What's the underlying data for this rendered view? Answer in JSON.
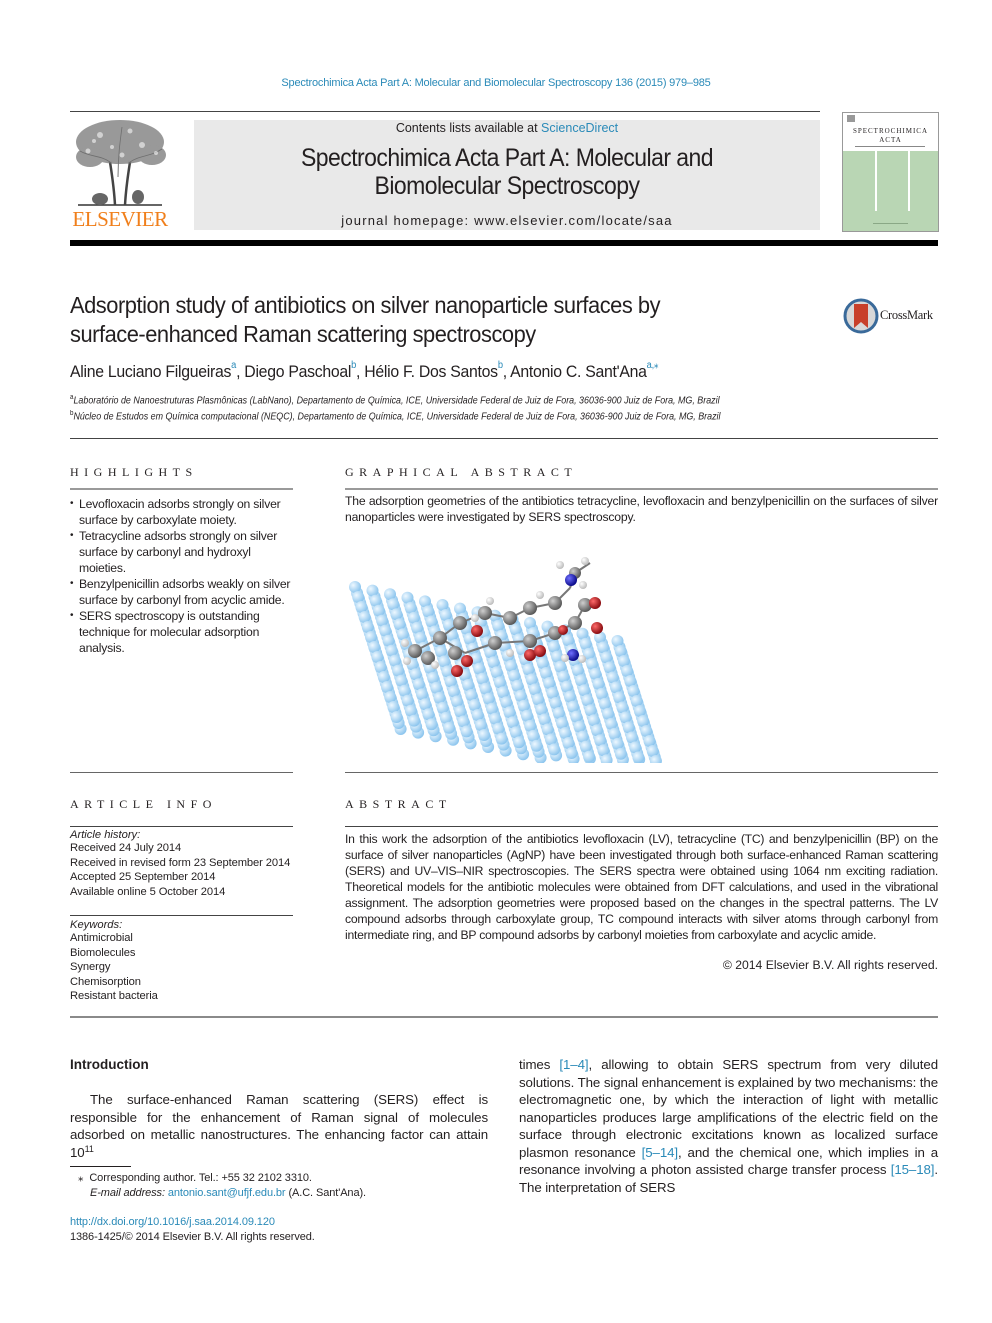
{
  "running_head": "Spectrochimica Acta Part A: Molecular and Biomolecular Spectroscopy 136 (2015) 979–985",
  "masthead": {
    "publisher": "ELSEVIER",
    "contents_prefix": "Contents lists available at ",
    "contents_link": "ScienceDirect",
    "journal_title_line1": "Spectrochimica Acta Part A: Molecular and",
    "journal_title_line2": "Biomolecular Spectroscopy",
    "homepage_prefix": "journal homepage: ",
    "homepage_url": "www.elsevier.com/locate/saa",
    "cover_title_line1": "SPECTROCHIMICA",
    "cover_title_line2": "ACTA"
  },
  "article": {
    "title_line1": "Adsorption study of antibiotics on silver nanoparticle surfaces by",
    "title_line2": "surface-enhanced Raman scattering spectroscopy",
    "crossmark_label": "CrossMark",
    "authors": [
      {
        "name": "Aline Luciano Filgueiras",
        "sup": "a",
        "sep": ", "
      },
      {
        "name": "Diego Paschoal",
        "sup": "b",
        "sep": ", "
      },
      {
        "name": "Hélio F. Dos Santos",
        "sup": "b",
        "sep": ", "
      },
      {
        "name": "Antonio C. Sant'Ana",
        "sup": "a,⁎",
        "sep": ""
      }
    ],
    "affiliations": [
      {
        "mark": "a",
        "text": "Laboratório de Nanoestruturas Plasmônicas (LabNano), Departamento de Química, ICE, Universidade Federal de Juiz de Fora, 36036-900 Juiz de Fora, MG, Brazil"
      },
      {
        "mark": "b",
        "text": "Núcleo de Estudos em Química computacional (NEQC), Departamento de Química, ICE, Universidade Federal de Juiz de Fora, 36036-900 Juiz de Fora, MG, Brazil"
      }
    ]
  },
  "highlights": {
    "heading": "HIGHLIGHTS",
    "items": [
      "Levofloxacin adsorbs strongly on silver surface by carboxylate moiety.",
      "Tetracycline adsorbs strongly on silver surface by carbonyl and hydroxyl moieties.",
      "Benzylpenicillin adsorbs weakly on silver surface by carbonyl from acyclic amide.",
      "SERS spectroscopy is outstanding technique for molecular adsorption analysis."
    ]
  },
  "graphical_abstract": {
    "heading": "GRAPHICAL ABSTRACT",
    "text": "The adsorption geometries of the antibiotics tetracycline, levofloxacin and benzylpenicillin on the surfaces of silver nanoparticles were investigated by SERS spectroscopy.",
    "image_alt": "Molecular model of an antibiotic adsorbed on a silver nanoparticle lattice"
  },
  "article_info": {
    "heading": "ARTICLE INFO",
    "history_label": "Article history:",
    "history": [
      "Received 24 July 2014",
      "Received in revised form 23 September 2014",
      "Accepted 25 September 2014",
      "Available online 5 October 2014"
    ],
    "keywords_label": "Keywords:",
    "keywords": [
      "Antimicrobial",
      "Biomolecules",
      "Synergy",
      "Chemisorption",
      "Resistant bacteria"
    ]
  },
  "abstract": {
    "heading": "ABSTRACT",
    "text": "In this work the adsorption of the antibiotics levofloxacin (LV), tetracycline (TC) and benzylpenicillin (BP) on the surface of silver nanoparticles (AgNP) have been investigated through both surface-enhanced Raman scattering (SERS) and UV–VIS–NIR spectroscopies. The SERS spectra were obtained using 1064 nm exciting radiation. Theoretical models for the antibiotic molecules were obtained from DFT calculations, and used in the vibrational assignment. The adsorption geometries were proposed based on the changes in the spectral patterns. The LV compound adsorbs through carboxylate group, TC compound interacts with silver atoms through carbonyl from intermediate ring, and BP compound adsorbs by carbonyl moieties from carboxylate and acyclic amide.",
    "copyright": "© 2014 Elsevier B.V. All rights reserved."
  },
  "introduction": {
    "heading": "Introduction",
    "left_text": "The surface-enhanced Raman scattering (SERS) effect is responsible for the enhancement of Raman signal of molecules adsorbed on metallic nanostructures. The enhancing factor can attain 10",
    "left_sup": "11",
    "right_segments": [
      {
        "t": "times ",
        "ref": false
      },
      {
        "t": "[1–4]",
        "ref": true
      },
      {
        "t": ", allowing to obtain SERS spectrum from very diluted solutions. The signal enhancement is explained by two mechanisms: the electromagnetic one, by which the interaction of light with metallic nanoparticles produces large amplifications of the electric field on the surface through electronic excitations known as localized surface plasmon resonance ",
        "ref": false
      },
      {
        "t": "[5–14]",
        "ref": true
      },
      {
        "t": ", and the chemical one, which implies in a resonance involving a photon assisted charge transfer process ",
        "ref": false
      },
      {
        "t": "[15–18]",
        "ref": true
      },
      {
        "t": ". The interpretation of SERS",
        "ref": false
      }
    ]
  },
  "footnotes": {
    "corresponding_mark": "⁎",
    "corresponding": "Corresponding author. Tel.: +55 32 2102 3310.",
    "email_label": "E-mail address: ",
    "email": "antonio.sant@ufjf.edu.br",
    "email_suffix": " (A.C. Sant'Ana).",
    "doi": "http://dx.doi.org/10.1016/j.saa.2014.09.120",
    "issn_line": "1386-1425/© 2014 Elsevier B.V. All rights reserved."
  },
  "colors": {
    "link": "#2a8ab8",
    "elsevier_orange": "#f07f1b",
    "masthead_bg": "#e9e9e9",
    "cover_green": "#b9d6b4",
    "oxygen": "#c0151b",
    "nitrogen": "#1a1ad0",
    "carbon": "#8a8a8a",
    "hydrogen": "#eeeeee",
    "silver": "#a9d8f5"
  }
}
